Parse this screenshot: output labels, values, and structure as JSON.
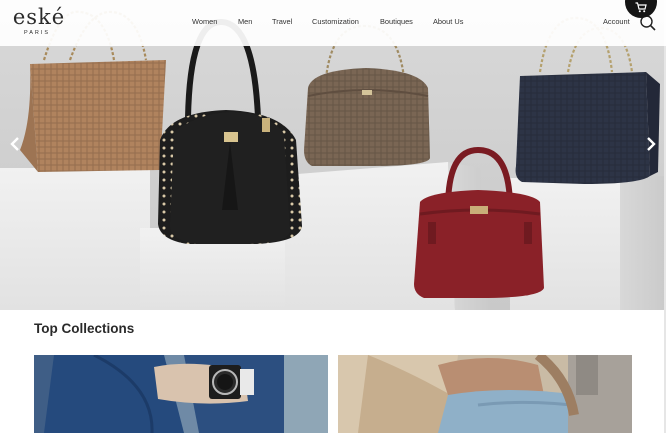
{
  "brand": {
    "name": "eské",
    "tagline": "PARIS"
  },
  "nav": {
    "items": [
      {
        "id": "women",
        "label": "Women"
      },
      {
        "id": "men",
        "label": "Men"
      },
      {
        "id": "travel",
        "label": "Travel"
      },
      {
        "id": "customization",
        "label": "Customization"
      },
      {
        "id": "boutiques",
        "label": "Boutiques"
      },
      {
        "id": "about",
        "label": "About Us"
      }
    ],
    "account_label": "Account"
  },
  "icons": {
    "cart": "cart-icon",
    "search": "search-icon",
    "prev": "chevron-left-icon",
    "next": "chevron-right-icon"
  },
  "collections": {
    "title": "Top Collections"
  },
  "colors": {
    "accent": "#151515",
    "hero_bg": "#d3d3d3",
    "bag_tan": "#b0835e",
    "bag_black": "#1f1f1f",
    "bag_taupe": "#7a6654",
    "bag_navy": "#2d3446",
    "bag_red": "#8a2128"
  }
}
